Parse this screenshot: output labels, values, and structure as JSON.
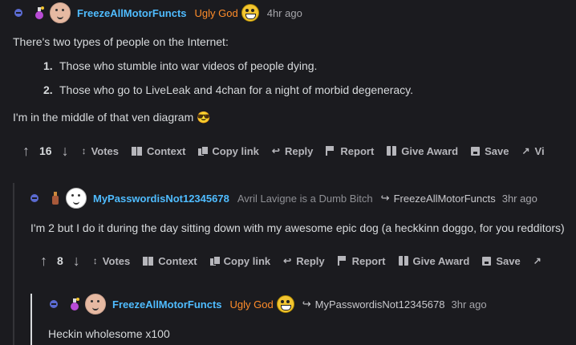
{
  "comments": [
    {
      "user": "FreezeAllMotorFuncts",
      "flair": "Ugly God",
      "time": "4hr ago",
      "body": {
        "intro": "There's two types of people on the Internet:",
        "list": [
          {
            "num": "1.",
            "text": "Those who stumble into war videos of people dying."
          },
          {
            "num": "2.",
            "text": "Those who go to LiveLeak and 4chan for a night of morbid degeneracy."
          }
        ],
        "outro": "I'm in the middle of that ven diagram",
        "outro_emoji": "😎"
      },
      "score": "16"
    },
    {
      "user": "MyPasswordisNot12345678",
      "flair": "Avril Lavigne is a Dumb Bitch",
      "reply_to": "FreezeAllMotorFuncts",
      "time": "3hr ago",
      "body": "I'm 2 but I do it during the day sitting down with my awesome epic dog (a heckkinn doggo, for you redditors)",
      "score": "8"
    },
    {
      "user": "FreezeAllMotorFuncts",
      "flair": "Ugly God",
      "reply_to": "MyPasswordisNot12345678",
      "time": "3hr ago",
      "body": "Heckin wholesome x100"
    }
  ],
  "actions": {
    "votes": "Votes",
    "context": "Context",
    "copy_link": "Copy link",
    "reply": "Reply",
    "report": "Report",
    "give_award": "Give Award",
    "save": "Save",
    "view_partial": "Vi"
  },
  "colors": {
    "background": "#1b1b1f",
    "username": "#4fbcff",
    "flair_orange": "#ff8c2a",
    "collapse_dot": "#5b6bd1"
  },
  "icons": {
    "upvote": "↑",
    "downvote": "↓",
    "votes": "↕",
    "reply": "↩",
    "expand": "↗",
    "reply_arrow": "↪"
  }
}
